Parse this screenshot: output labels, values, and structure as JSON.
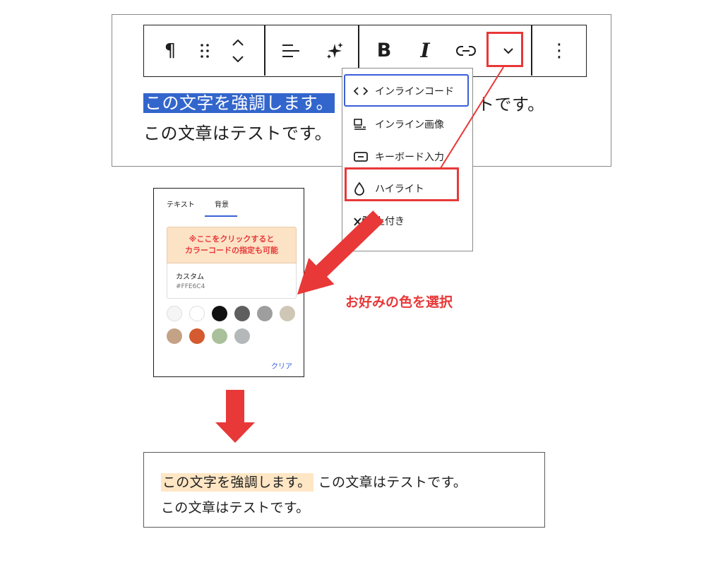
{
  "toolbar": {
    "paragraph_symbol": "¶",
    "bold_label": "B",
    "italic_label": "I",
    "more_symbol": "⋮"
  },
  "editor": {
    "selected_text": "この文字を強調します。",
    "line1_rest": "トです。",
    "line2": "この文章はテストです。"
  },
  "dropdown": {
    "items": [
      {
        "label": "インラインコード",
        "icon": "code-icon"
      },
      {
        "label": "インライン画像",
        "icon": "image-icon"
      },
      {
        "label": "キーボード入力",
        "icon": "keyboard-icon"
      },
      {
        "label": "ハイライト",
        "icon": "drop-icon"
      },
      {
        "label": "上付き",
        "icon": "superscript-icon"
      }
    ]
  },
  "color_panel": {
    "tabs": [
      "テキスト",
      "背景"
    ],
    "active_tab": "背景",
    "note_line1": "※ここをクリックすると",
    "note_line2": "カラーコードの指定も可能",
    "custom_label": "カスタム",
    "custom_hex": "#FFE6C4",
    "swatches": [
      "#f5f5f5",
      "#ffffff",
      "#111111",
      "#5e5e5e",
      "#9e9e9e",
      "#cfc6b6",
      "#c4a286",
      "#d45a30",
      "#a9c09a",
      "#b4b8b8"
    ],
    "clear_label": "クリア"
  },
  "annotation": {
    "caption": "お好みの色を選択",
    "color": "#e83838"
  },
  "result": {
    "highlighted_text": "この文字を強調します。",
    "line1_rest": "この文章はテストです。",
    "line2": "この文章はテストです。",
    "highlight_color": "#FFE6C4"
  }
}
